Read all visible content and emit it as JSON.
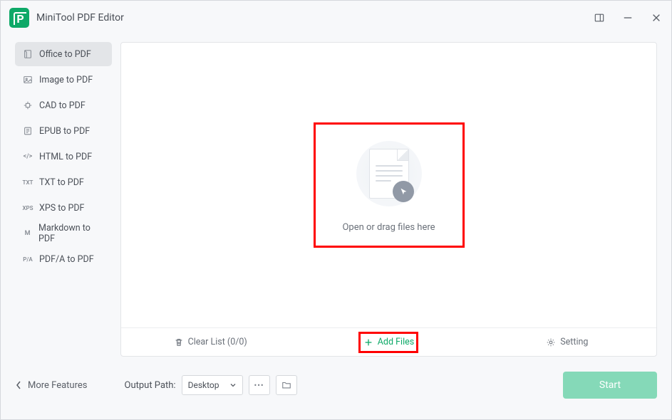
{
  "app": {
    "title": "MiniTool PDF Editor"
  },
  "sidebar": {
    "items": [
      {
        "label": "Office to PDF",
        "badge": ""
      },
      {
        "label": "Image to PDF",
        "badge": ""
      },
      {
        "label": "CAD to PDF",
        "badge": ""
      },
      {
        "label": "EPUB to PDF",
        "badge": ""
      },
      {
        "label": "HTML to PDF",
        "badge": "</>"
      },
      {
        "label": "TXT to PDF",
        "badge": "TXT"
      },
      {
        "label": "XPS to PDF",
        "badge": "XPS"
      },
      {
        "label": "Markdown to PDF",
        "badge": "M"
      },
      {
        "label": "PDF/A to PDF",
        "badge": "P/A"
      }
    ]
  },
  "drop": {
    "text": "Open or drag files here"
  },
  "actions": {
    "clear": "Clear List (0/0)",
    "add": "Add Files",
    "setting": "Setting"
  },
  "footer": {
    "more": "More Features",
    "output_label": "Output Path:",
    "output_value": "Desktop",
    "ellipsis": "•••",
    "start": "Start"
  }
}
